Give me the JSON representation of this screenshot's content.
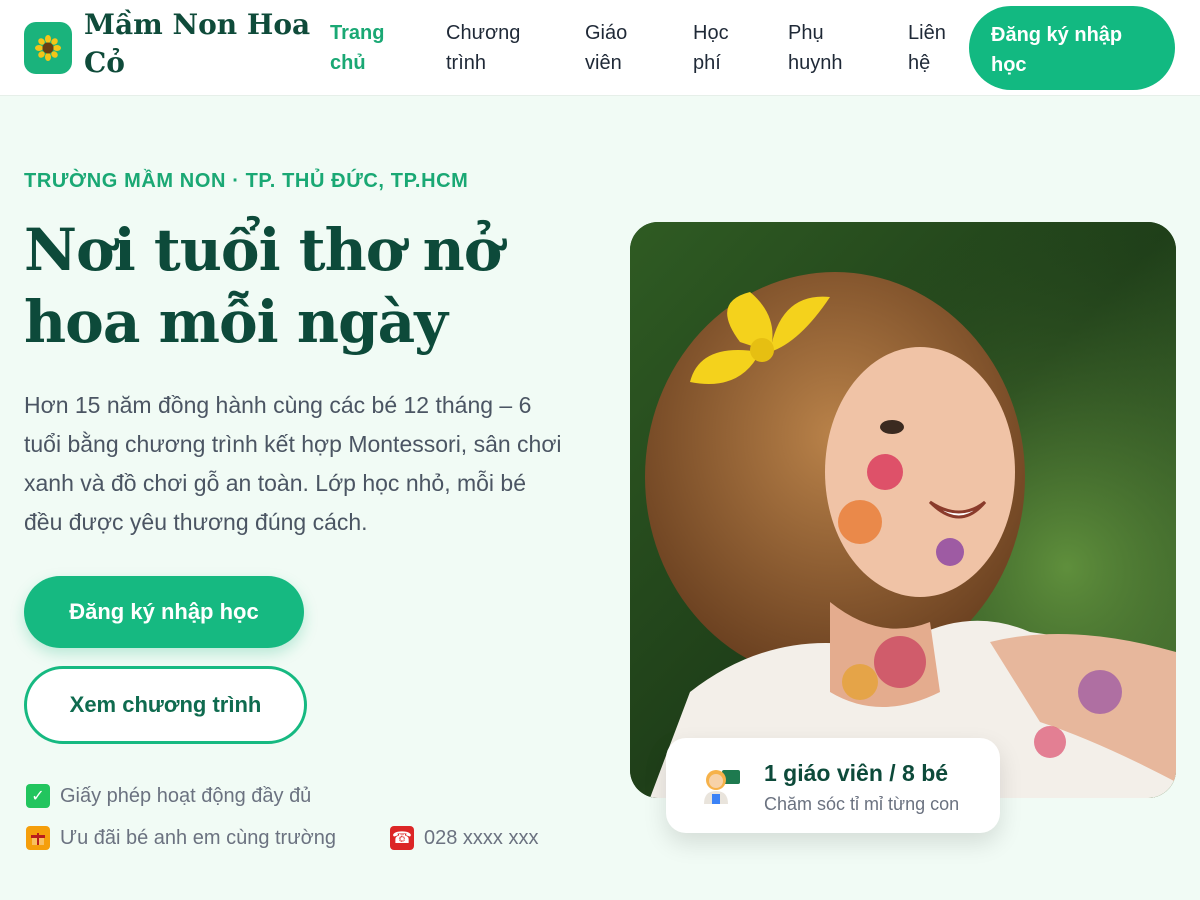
{
  "header": {
    "logo_icon": "sunflower-icon",
    "brand": "Mầm Non Hoa Cỏ",
    "nav": [
      {
        "label": "Trang chủ",
        "active": true
      },
      {
        "label": "Chương trình",
        "active": false
      },
      {
        "label": "Giáo viên",
        "active": false
      },
      {
        "label": "Học phí",
        "active": false
      },
      {
        "label": "Phụ huynh",
        "active": false
      },
      {
        "label": "Liên hệ",
        "active": false
      }
    ],
    "cta": "Đăng ký nhập học"
  },
  "hero": {
    "eyebrow": "TRƯỜNG MẦM NON · TP. THỦ ĐỨC, TP.HCM",
    "title": "Nơi tuổi thơ nở hoa mỗi ngày",
    "description": "Hơn 15 năm đồng hành cùng các bé 12 tháng – 6 tuổi bằng chương trình kết hợp Montessori, sân chơi xanh và đồ chơi gỗ an toàn. Lớp học nhỏ, mỗi bé đều được yêu thương đúng cách.",
    "primary_button": "Đăng ký nhập học",
    "secondary_button": "Xem chương trình",
    "features": [
      {
        "icon": "check-icon",
        "text": "Giấy phép hoạt động đầy đủ"
      },
      {
        "icon": "gift-icon",
        "text": "Ưu đãi bé anh em cùng trường"
      },
      {
        "icon": "phone-icon",
        "text": "028 xxxx xxx"
      }
    ],
    "image": "child-with-paint-photo",
    "ratio_card": {
      "icon": "teacher-icon",
      "title": "1 giáo viên / 8 bé",
      "subtitle": "Chăm sóc tỉ mỉ từng con"
    }
  },
  "colors": {
    "accent": "#16b981",
    "dark_green": "#0d4a3a",
    "background": "#f1fbf5"
  }
}
